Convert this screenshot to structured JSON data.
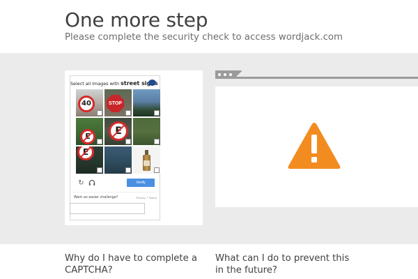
{
  "header": {
    "title": "One more step",
    "subtitle": "Please complete the security check to access wordjack.com"
  },
  "captcha": {
    "instruction_prefix": "Select all images with",
    "instruction_target": "street signs",
    "tiles": [
      {
        "content": "40 speed limit sign",
        "label": "40"
      },
      {
        "content": "stop sign",
        "label": "STOP"
      },
      {
        "content": "river and trees",
        "label": ""
      },
      {
        "content": "no parking sign",
        "label": "E"
      },
      {
        "content": "no parking sign",
        "label": "E"
      },
      {
        "content": "grass field",
        "label": ""
      },
      {
        "content": "no parking sign",
        "label": "E"
      },
      {
        "content": "trees",
        "label": ""
      },
      {
        "content": "bottle",
        "label": ""
      }
    ],
    "verify_label": "Verify",
    "easier_label": "Want an easier challenge?",
    "legal_label": "Privacy • Terms",
    "response_value": ""
  },
  "icons": {
    "refresh": "refresh-icon",
    "audio": "headphones-icon",
    "warning": "warning-triangle-icon"
  },
  "colors": {
    "warning": "#f28c21",
    "verify_button": "#4a90e2",
    "band": "#ebebeb",
    "browser_bar": "#9b9b9b"
  },
  "faq": {
    "q1": "Why do I have to complete a CAPTCHA?",
    "q2": "What can I do to prevent this in the future?"
  }
}
